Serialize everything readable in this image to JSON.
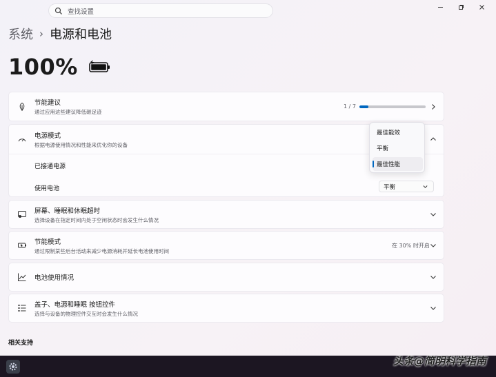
{
  "search": {
    "placeholder": "查找设置"
  },
  "breadcrumb": {
    "parent": "系统",
    "separator": "›",
    "current": "电源和电池"
  },
  "battery": {
    "percent": "100%",
    "level": 1.0
  },
  "cards": {
    "energy_recommendations": {
      "title": "节能建议",
      "desc": "通过应用这些建议降低碳足迹",
      "progress_text": "1 / 7",
      "progress": 0.14
    },
    "power_mode": {
      "title": "电源模式",
      "desc": "根据电源使用情况和性能来优化你的设备",
      "plugged_in_label": "已接通电源",
      "on_battery_label": "使用电池",
      "on_battery_value": "平衡",
      "options": [
        "最佳能效",
        "平衡",
        "最佳性能"
      ],
      "selected_option": "最佳性能"
    },
    "screen_sleep": {
      "title": "屏幕、睡眠和休眠超时",
      "desc": "选择设备在指定时间内处于空闲状态时会发生什么情况"
    },
    "energy_saver": {
      "title": "节能模式",
      "desc": "通过限制某些后台活动来减少电源消耗并延长电池使用时间",
      "status": "在 30% 时开启"
    },
    "battery_usage": {
      "title": "电池使用情况"
    },
    "lid_power": {
      "title": "盖子、电源和睡眠 按钮控件",
      "desc": "选择与设备的物理控件交互时会发生什么情况"
    }
  },
  "related": {
    "label": "相关支持"
  },
  "watermark": "头条@简明科学指南",
  "colors": {
    "accent": "#0067c0",
    "taskbar": "#1c1622"
  }
}
